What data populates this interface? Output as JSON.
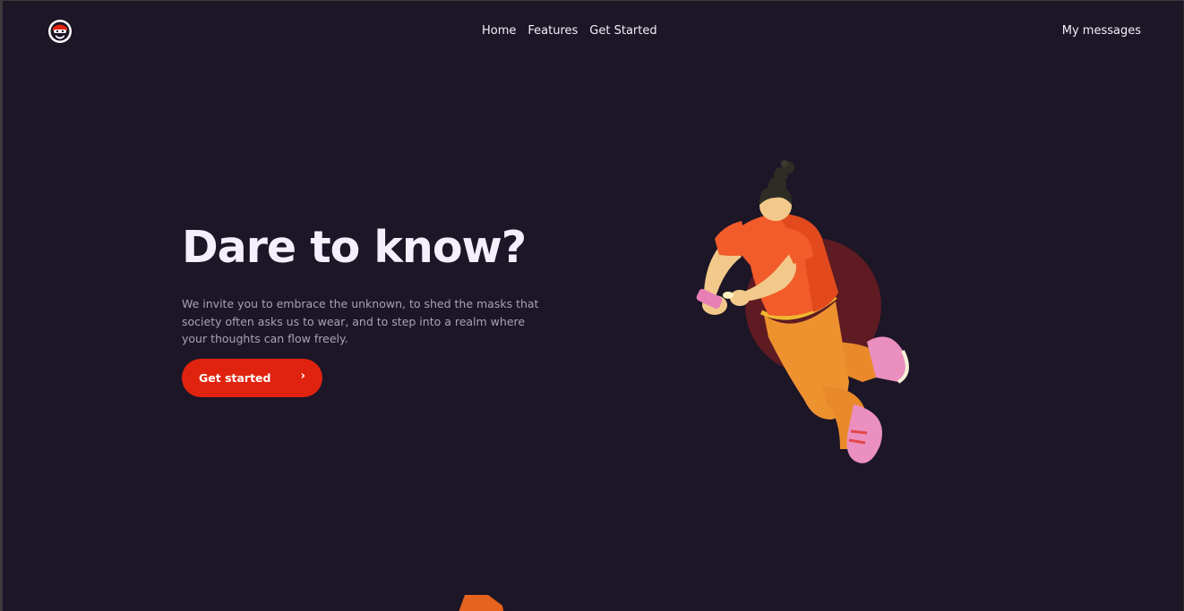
{
  "nav": {
    "links": [
      "Home",
      "Features",
      "Get Started"
    ],
    "messages": "My messages"
  },
  "hero": {
    "title": "Dare to know?",
    "text": "We invite you to embrace the unknown, to shed the masks that society often asks us to wear, and to step into a realm where your thoughts can flow freely.",
    "cta": "Get started",
    "cta_icon": "›"
  },
  "colors": {
    "background": "#1c1627",
    "accent": "#e0230f",
    "figure_circle": "#5e1b22"
  },
  "icons": {
    "logo": "masked-face-logo-icon",
    "cta": "chevron-right-icon"
  }
}
